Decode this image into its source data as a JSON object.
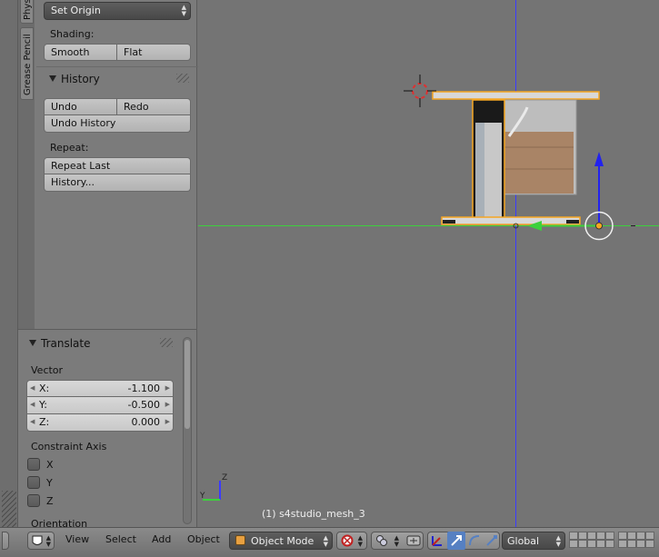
{
  "tool_shelf": {
    "tabs": [
      "Physics",
      "Grease Pencil"
    ],
    "set_origin": "Set Origin",
    "shading_label": "Shading:",
    "smooth_label": "Smooth",
    "flat_label": "Flat",
    "history_title": "History",
    "undo_label": "Undo",
    "redo_label": "Redo",
    "undo_history_label": "Undo History",
    "repeat_label": "Repeat:",
    "repeat_last_label": "Repeat Last",
    "history_dots_label": "History..."
  },
  "operator_panel": {
    "title": "Translate",
    "vector_label": "Vector",
    "x_label": "X:",
    "x_value": "-1.100",
    "y_label": "Y:",
    "y_value": "-0.500",
    "z_label": "Z:",
    "z_value": "0.000",
    "constraint_label": "Constraint Axis",
    "cx": "X",
    "cy": "Y",
    "cz": "Z",
    "orientation_label": "Orientation"
  },
  "viewport": {
    "object_label": "(1) s4studio_mesh_3",
    "axis_z": "Z",
    "axis_y": "Y"
  },
  "header": {
    "view": "View",
    "select": "Select",
    "add": "Add",
    "object": "Object",
    "mode": "Object Mode",
    "orientation": "Global"
  },
  "colors": {
    "selection_outline": "#f5a623",
    "axis_green": "#3cd03c",
    "axis_blue": "#3a3aff",
    "gizmo_red": "#e03030"
  }
}
